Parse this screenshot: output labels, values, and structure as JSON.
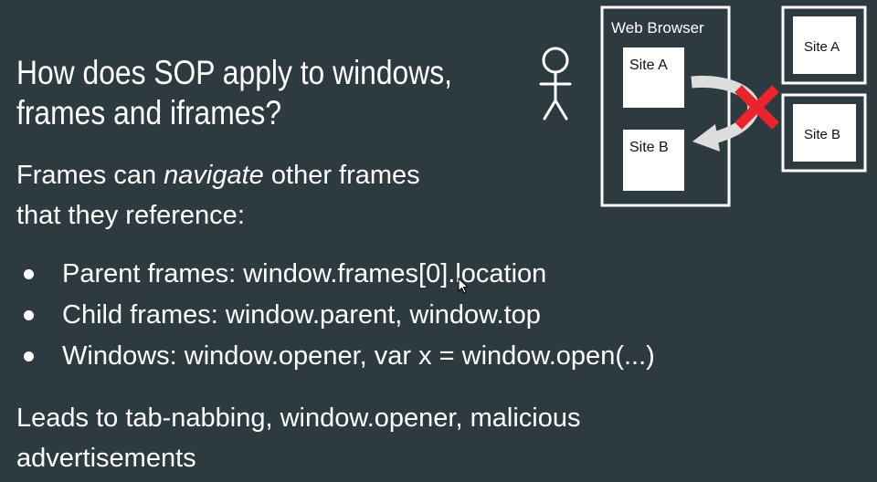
{
  "slide": {
    "title_lines": [
      "How does SOP apply to windows,",
      "frames and iframes?"
    ],
    "intro": {
      "prefix": "Frames can ",
      "emphasis": "navigate",
      "suffix": " other frames",
      "line2": "that they reference:"
    },
    "bullets": [
      "Parent frames: window.frames[0].location",
      "Child frames: window.parent, window.top",
      "Windows: window.opener, var x = window.open(...)"
    ],
    "outro_lines": [
      "Leads to tab-nabbing, window.opener, malicious",
      "advertisements"
    ]
  },
  "diagram": {
    "browser_label": "Web Browser",
    "browser_frames": [
      "Site A",
      "Site B"
    ],
    "external_sites": [
      "Site A",
      "Site B"
    ],
    "colors": {
      "background": "#2d3a40",
      "box_fill": "#ffffff",
      "box_border": "#ffffff",
      "arrow": "#e0e0e0",
      "cross": "#e8252e"
    },
    "icons": [
      "stick-figure-icon",
      "blocked-cross-icon",
      "arrow-icon",
      "mouse-cursor-icon"
    ]
  }
}
